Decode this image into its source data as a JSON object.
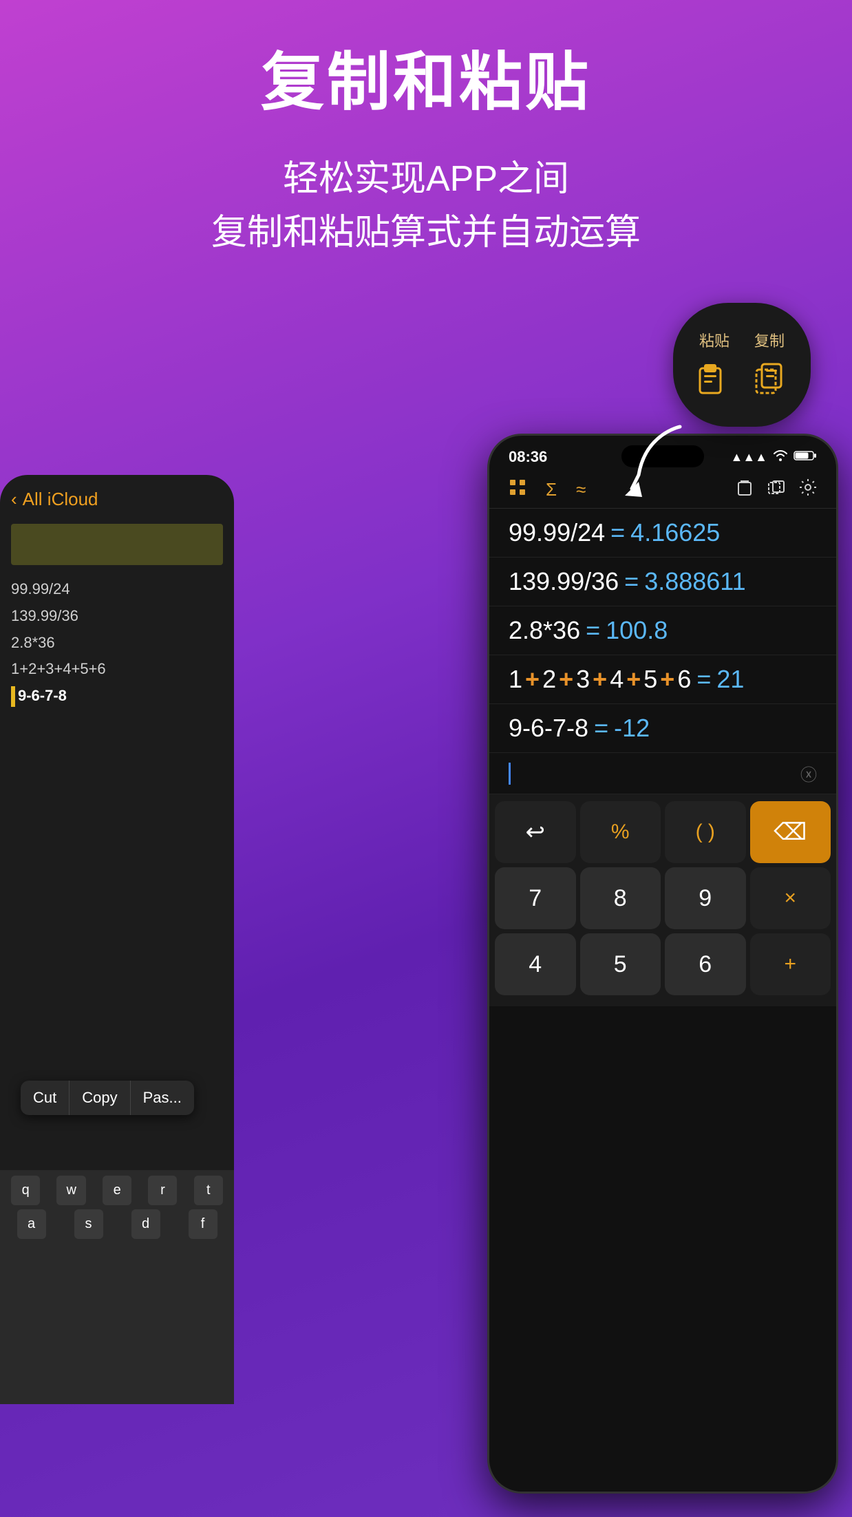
{
  "background": {
    "gradient": "purple-violet"
  },
  "header": {
    "title": "复制和粘贴",
    "subtitle_line1": "轻松实现APP之间",
    "subtitle_line2": "复制和粘贴算式并自动运算"
  },
  "floating_pill": {
    "label_paste": "粘贴",
    "label_copy": "复制"
  },
  "back_phone": {
    "nav_back": "All iCloud",
    "notes": [
      "99.99/24",
      "139.99/36",
      "2.8*36",
      "1+2+3+4+5+6",
      "9-6-7-8"
    ],
    "context_menu": {
      "cut": "Cut",
      "copy": "Copy",
      "paste": "Pas..."
    },
    "keyboard_rows": [
      [
        "q",
        "w",
        "e",
        "r",
        "t"
      ],
      [
        "a",
        "s",
        "d",
        "f"
      ]
    ]
  },
  "front_phone": {
    "status_bar": {
      "time": "08:36",
      "signal_icon": "signal",
      "wifi_icon": "wifi",
      "battery": "61"
    },
    "toolbar": {
      "icon1": "grid",
      "icon2": "sigma",
      "icon3": "approx",
      "icon4": "clipboard",
      "icon5": "copy-frame",
      "icon6": "gear"
    },
    "calculations": [
      {
        "expr": "99.99/24",
        "result": "4.16625"
      },
      {
        "expr": "139.99/36",
        "result": "3.888611"
      },
      {
        "expr": "2.8*36",
        "result": "100.8"
      },
      {
        "expr": "1+2+3+4+5+6",
        "result": "21"
      },
      {
        "expr": "9-6-7-8",
        "result": "-12"
      }
    ],
    "keypad": {
      "row1": [
        "↩",
        "%",
        "( )",
        "⌫"
      ],
      "row2": [
        "7",
        "8",
        "9",
        "×"
      ],
      "row3": [
        "4",
        "5",
        "6",
        "+"
      ]
    }
  }
}
